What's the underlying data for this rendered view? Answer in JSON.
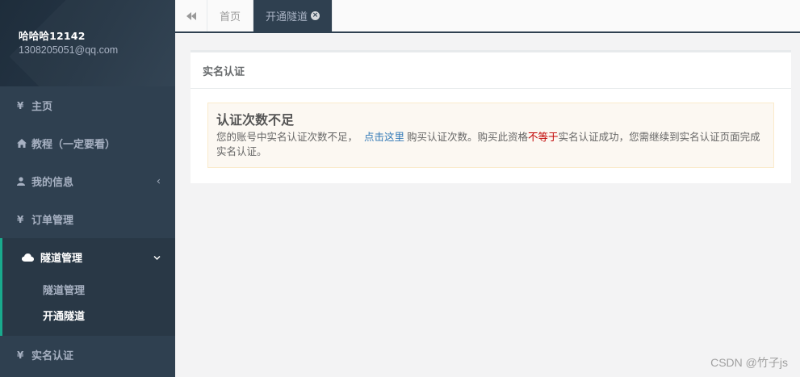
{
  "profile": {
    "name": "哈哈哈12142",
    "email": "1308205051@qq.com"
  },
  "sidebar": {
    "items": [
      {
        "icon": "¥",
        "label": "主页"
      },
      {
        "icon": "home-icon",
        "label": "教程（一定要看）"
      },
      {
        "icon": "user-icon",
        "label": "我的信息",
        "arrow": "‹"
      },
      {
        "icon": "¥",
        "label": "订单管理"
      },
      {
        "icon": "cloud-icon",
        "label": "隧道管理",
        "arrow": "⌄",
        "children": [
          {
            "label": "隧道管理"
          },
          {
            "label": "开通隧道"
          }
        ]
      },
      {
        "icon": "¥",
        "label": "实名认证"
      }
    ]
  },
  "tabs": {
    "back_icon": "«",
    "items": [
      {
        "label": "首页"
      },
      {
        "label": "开通隧道",
        "close": "×"
      }
    ]
  },
  "panel": {
    "title": "实名认证",
    "alert": {
      "title": "认证次数不足",
      "text_before": "您的账号中实名认证次数不足，",
      "link": "点击这里",
      "text_mid": "购买认证次数。购买此资格",
      "text_red": "不等于",
      "text_after": "实名认证成功，您需继续到实名认证页面完成实名认证。"
    }
  },
  "watermark": "CSDN @竹子js",
  "colors": {
    "sidebar_bg": "#2f4050",
    "active_border": "#19aa8d",
    "link": "#337ab7",
    "red": "#c00000",
    "alert_bg": "#fcf8f2"
  }
}
